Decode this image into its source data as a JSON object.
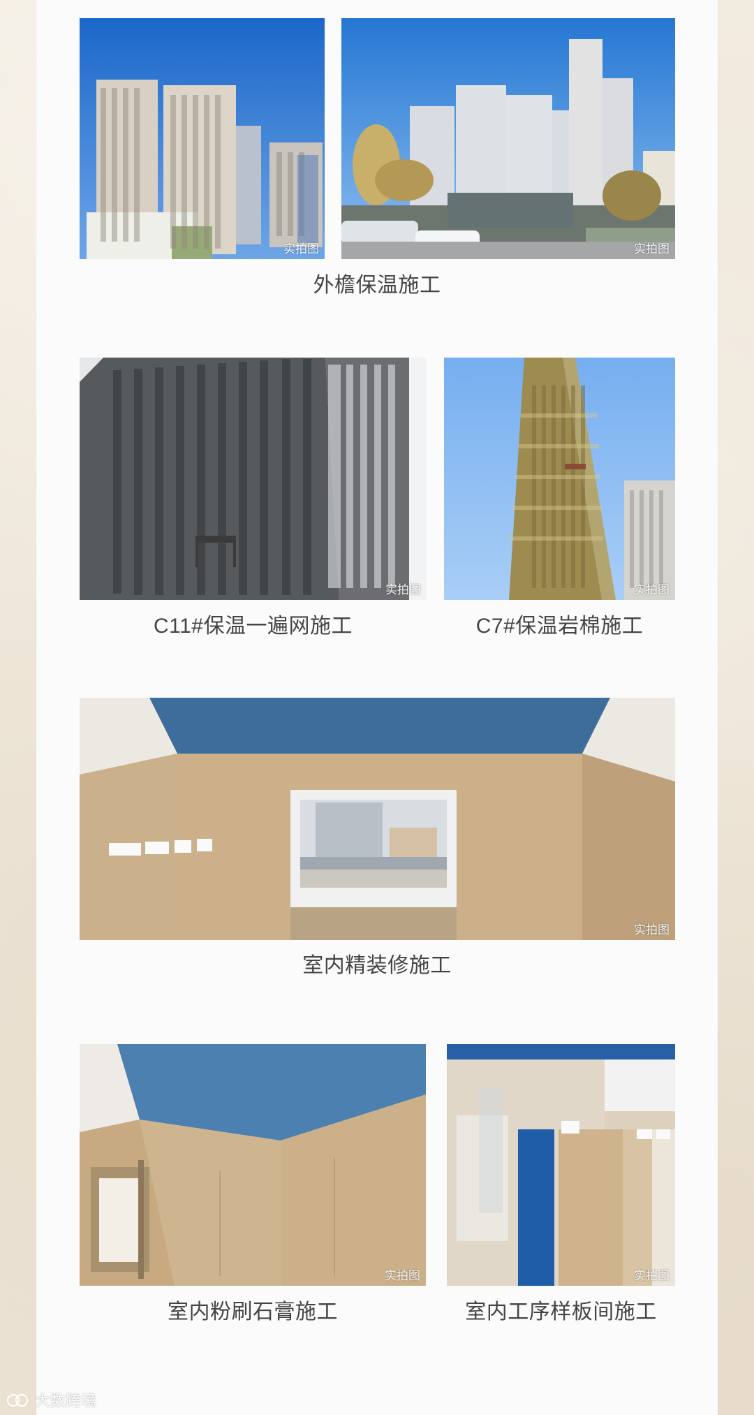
{
  "page": {
    "captions": {
      "row1": "外檐保温施工",
      "row2_left": "C11#保温一遍网施工",
      "row2_right": "C7#保温岩棉施工",
      "row3": "室内精装修施工",
      "row4_left": "室内粉刷石膏施工",
      "row4_right": "室内工序样板间施工"
    },
    "photo_watermark": "实拍图",
    "brand": {
      "text": "大数跨境"
    }
  }
}
